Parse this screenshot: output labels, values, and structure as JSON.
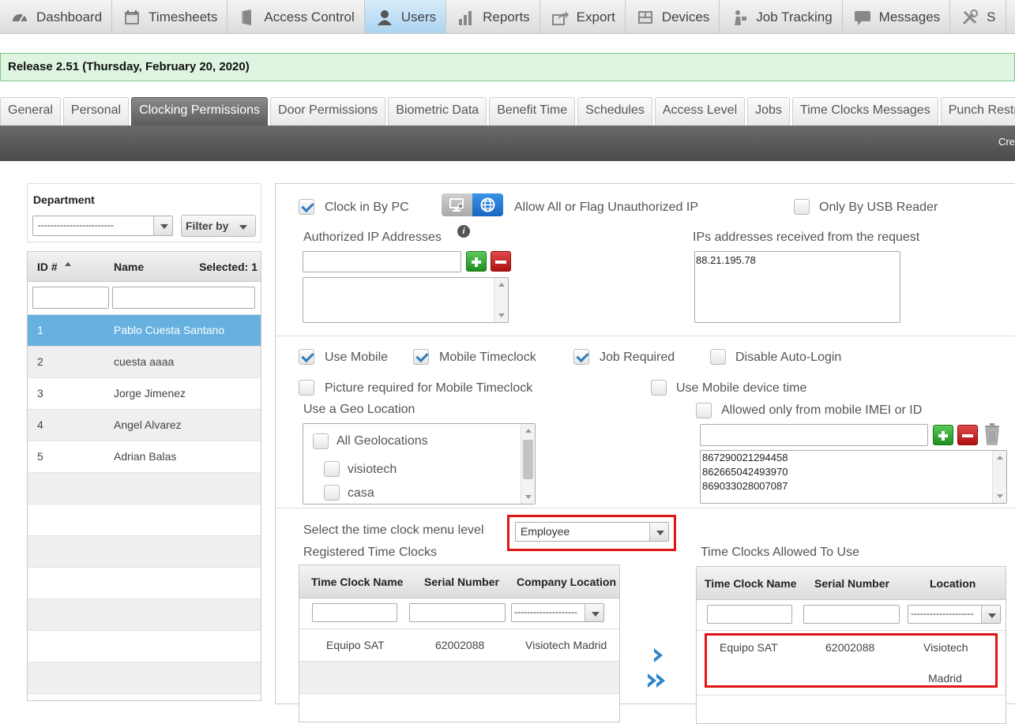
{
  "nav": [
    {
      "label": "Dashboard",
      "icon": "dashboard-gauge-icon"
    },
    {
      "label": "Timesheets",
      "icon": "calendar-icon"
    },
    {
      "label": "Access Control",
      "icon": "door-icon"
    },
    {
      "label": "Users",
      "icon": "user-icon",
      "active": true
    },
    {
      "label": "Reports",
      "icon": "bar-chart-icon"
    },
    {
      "label": "Export",
      "icon": "export-icon"
    },
    {
      "label": "Devices",
      "icon": "devices-icon"
    },
    {
      "label": "Job Tracking",
      "icon": "job-tracking-icon"
    },
    {
      "label": "Messages",
      "icon": "speech-bubble-icon"
    },
    {
      "label": "S",
      "icon": "tools-icon"
    }
  ],
  "release": "Release 2.51 (Thursday, February 20, 2020)",
  "subtabs": [
    "General",
    "Personal",
    "Clocking Permissions",
    "Door Permissions",
    "Biometric Data",
    "Benefit Time",
    "Schedules",
    "Access Level",
    "Jobs",
    "Time Clocks Messages",
    "Punch Restricti"
  ],
  "active_subtab": "Clocking Permissions",
  "toolbar": {
    "create_label": "Cre"
  },
  "department": {
    "label": "Department",
    "value": "------------------------",
    "filter_label": "Filter by"
  },
  "user_grid": {
    "col_id": "ID #",
    "col_name": "Name",
    "selected": "Selected: 1",
    "rows": [
      {
        "id": "1",
        "name": "Pablo Cuesta Santano",
        "selected": true
      },
      {
        "id": "2",
        "name": "cuesta aaaa"
      },
      {
        "id": "3",
        "name": "Jorge Jimenez"
      },
      {
        "id": "4",
        "name": "Angel Alvarez"
      },
      {
        "id": "5",
        "name": "Adrian Balas"
      }
    ]
  },
  "pc": {
    "clock_by_pc": "Clock in By PC",
    "allow_all": "Allow All or Flag Unauthorized IP",
    "only_usb": "Only By USB Reader",
    "authorized_ips": "Authorized IP Addresses",
    "ips_received": "IPs addresses received from the request",
    "received_ip": "88.21.195.78"
  },
  "mobile": {
    "use_mobile": "Use Mobile",
    "mobile_timeclock": "Mobile Timeclock",
    "job_required": "Job Required",
    "disable_autologin": "Disable Auto-Login",
    "picture_required": "Picture required for Mobile Timeclock",
    "use_device_time": "Use Mobile device time",
    "geo_label": "Use a Geo Location",
    "geo_items": [
      "All Geolocations",
      "visiotech",
      "casa"
    ],
    "imei_label": "Allowed only from mobile IMEI or ID",
    "imei_list": [
      "867290021294458",
      "862665042493970",
      "869033028007087"
    ]
  },
  "timeclocks": {
    "menu_level_label": "Select the time clock menu level",
    "menu_level_value": "Employee",
    "registered_label": "Registered Time Clocks",
    "allowed_label": "Time Clocks Allowed To Use",
    "registered_cols": [
      "Time Clock Name",
      "Serial Number",
      "Company Location"
    ],
    "allowed_cols": [
      "Time Clock Name",
      "Serial Number",
      "Location"
    ],
    "filter_select": "--------------------",
    "registered_rows": [
      {
        "name": "Equipo SAT",
        "serial": "62002088",
        "location": "Visiotech Madrid"
      }
    ],
    "allowed_rows": [
      {
        "name": "Equipo SAT",
        "serial": "62002088",
        "location_line1": "Visiotech",
        "location_line2": "Madrid"
      }
    ]
  },
  "colors": {
    "accent": "#67b1e0",
    "release_bg": "#dff5e2",
    "highlight": "#e01515",
    "add_green": "#2ea02e",
    "remove_red": "#c81a1a"
  }
}
